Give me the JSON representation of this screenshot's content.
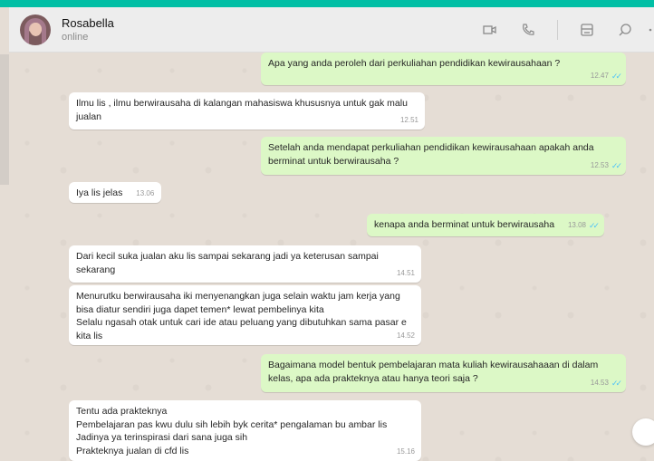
{
  "contact": {
    "name": "Rosabella",
    "status": "online"
  },
  "header_icons": [
    "video-call-icon",
    "voice-call-icon",
    "catalog-icon",
    "search-icon",
    "menu-icon"
  ],
  "colors": {
    "accent": "#00bfa5",
    "incoming": "#ffffff",
    "outgoing": "#dcf8c6",
    "read_tick": "#4fc3f7",
    "background": "#e5ddd5"
  },
  "messages": [
    {
      "dir": "out",
      "text": "Apa yang anda peroleh dari perkuliahan pendidikan kewirausahaan ?",
      "time": "12.47",
      "read": "✓✓"
    },
    {
      "dir": "in",
      "text": "Ilmu lis , ilmu berwirausaha di kalangan mahasiswa khususnya untuk gak malu\njualan",
      "time": "12.51"
    },
    {
      "dir": "out",
      "text": "Setelah anda mendapat perkuliahan pendidikan kewirausahaan apakah anda\nberminat untuk berwirausaha ?",
      "time": "12.53",
      "read": "✓✓"
    },
    {
      "dir": "in",
      "text": "Iya lis jelas",
      "time": "13.06"
    },
    {
      "dir": "out",
      "text": "kenapa anda berminat untuk berwirausaha",
      "time": "13.08",
      "read": "✓✓"
    },
    {
      "dir": "in",
      "text": "Dari kecil suka jualan aku lis sampai sekarang jadi ya keterusan sampai\nsekarang",
      "time": "14.51"
    },
    {
      "dir": "in",
      "text": "Menurutku berwirausaha iki menyenangkan juga selain waktu jam kerja yang\nbisa diatur sendiri juga dapet temen* lewat pembelinya kita\nSelalu ngasah otak untuk cari ide atau peluang yang dibutuhkan sama pasar e\nkita lis",
      "time": "14.52"
    },
    {
      "dir": "out",
      "text": "Bagaimana model bentuk pembelajaran mata kuliah kewirausahaaan di dalam\nkelas, apa ada prakteknya atau hanya teori saja ?",
      "time": "14.53",
      "read": "✓✓"
    },
    {
      "dir": "in",
      "text": "Tentu ada prakteknya\nPembelajaran pas kwu dulu sih lebih byk cerita* pengalaman bu ambar lis\nJadinya ya terinspirasi dari sana juga sih\nPrakteknya jualan di cfd lis",
      "time": "15.16"
    }
  ]
}
